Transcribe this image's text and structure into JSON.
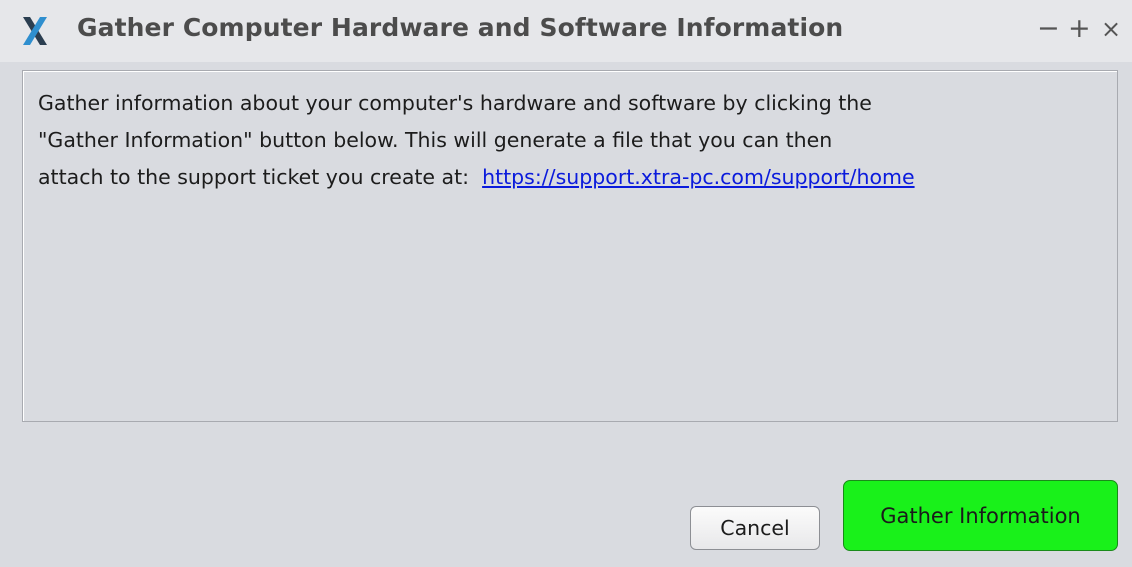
{
  "window": {
    "title": "Gather Computer Hardware and Software Information",
    "controls": {
      "minimize": "−",
      "maximize": "+",
      "close": "×"
    },
    "logo_icon": "xtra-pc-logo-icon"
  },
  "info": {
    "line1": "Gather information about your computer's hardware and software by clicking the",
    "line2": "\"Gather Information\" button below.  This will generate a file that you can then",
    "line3_prefix": "attach to the support ticket you create at:  ",
    "link_text": "https://support.xtra-pc.com/support/home"
  },
  "buttons": {
    "cancel": "Cancel",
    "gather": "Gather Information"
  },
  "colors": {
    "background": "#d9dbe0",
    "link": "#0b1bdc",
    "gather_button": "#19f11a"
  }
}
